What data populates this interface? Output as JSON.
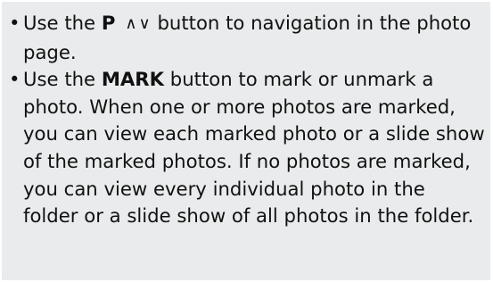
{
  "bullets": [
    {
      "before": "Use the ",
      "key": "P",
      "arrows": [
        "∧",
        "∨"
      ],
      "after": " button to navigation in the photo page."
    },
    {
      "before": "Use the ",
      "key": "MARK",
      "after": " button to mark or unmark a photo. When one or more photos are marked, you can view each marked photo or a slide show of the marked photos. If no photos are marked, you can view every individual photo in the folder or a slide show of all photos in the folder."
    }
  ],
  "bullet_symbol": "•",
  "colors": {
    "panel_background": "#eaebec",
    "text": "#111111"
  }
}
